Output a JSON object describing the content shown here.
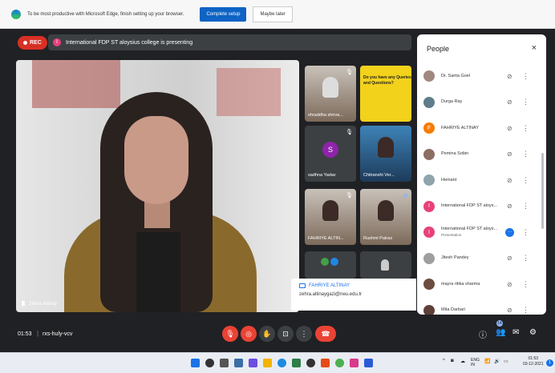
{
  "edge_bar": {
    "message": "To be most productive with Microsoft Edge, finish setting up your browser.",
    "primary_button": "Complete setup",
    "secondary_button": "Maybe later"
  },
  "meeting": {
    "rec_label": "REC",
    "presenter_initial": "I",
    "presenting_text": "International FDP ST aloysius college is presenting",
    "main_speaker": "Zehra Altinay",
    "time": "01:53",
    "code": "rxs-huly-vcv",
    "participants_badge": "14"
  },
  "tiles": [
    {
      "name": "shraddha shriva...",
      "type": "photo"
    },
    {
      "name": "",
      "type": "slide",
      "text": "Do you have any Queries and Questions?"
    },
    {
      "name": "sadhna Yadav",
      "type": "avatar",
      "initial": "S",
      "color": "#8e24aa"
    },
    {
      "name": "Chitranshi Ver...",
      "type": "photo-blue"
    },
    {
      "name": "FAHRIYE ALTIN...",
      "type": "photo"
    },
    {
      "name": "Rushmi Patras",
      "type": "photo"
    },
    {
      "name": "",
      "type": "avatars"
    },
    {
      "name": "",
      "type": "photo"
    }
  ],
  "info_card": {
    "name": "FAHRIYE ALTINAY",
    "email": "zehra.altinaygazi@neu.edu.tr"
  },
  "people": {
    "title": "People",
    "close": "×",
    "items": [
      {
        "name": "Dr. Sarita Goel",
        "sub": "",
        "avatar_color": "#a1887f",
        "initial": ""
      },
      {
        "name": "Durga Ray",
        "sub": "",
        "avatar_color": "#607d8b",
        "initial": ""
      },
      {
        "name": "FAHRIYE ALTINAY",
        "sub": "",
        "avatar_color": "#f57c00",
        "initial": "F"
      },
      {
        "name": "Pemina Sobin",
        "sub": "",
        "avatar_color": "#8d6e63",
        "initial": ""
      },
      {
        "name": "Hemant",
        "sub": "",
        "avatar_color": "#90a4ae",
        "initial": ""
      },
      {
        "name": "International FDP ST aloys...",
        "sub": "",
        "avatar_color": "#e8417a",
        "initial": "I"
      },
      {
        "name": "International FDP ST aloys...",
        "sub": "Presentation",
        "avatar_color": "#e8417a",
        "initial": "I"
      },
      {
        "name": "Jitesh Pandey",
        "sub": "",
        "avatar_color": "#9e9e9e",
        "initial": ""
      },
      {
        "name": "mayra ritika sharma",
        "sub": "",
        "avatar_color": "#6d4c41",
        "initial": ""
      },
      {
        "name": "Mita Darbari",
        "sub": "",
        "avatar_color": "#5d4037",
        "initial": ""
      }
    ]
  },
  "taskbar": {
    "lang": "ENG\nIN",
    "time": "01:53",
    "date": "03-12-2021",
    "notifications": "1"
  }
}
